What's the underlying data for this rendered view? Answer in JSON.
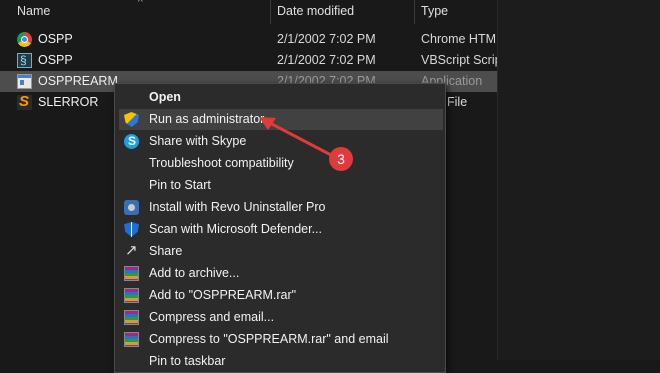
{
  "columns": {
    "name": "Name",
    "date_modified": "Date modified",
    "type": "Type"
  },
  "files": [
    {
      "name": "OSPP",
      "date": "2/1/2002 7:02 PM",
      "type": "Chrome HTML Document",
      "icon": "chrome-file-icon",
      "selected": false
    },
    {
      "name": "OSPP",
      "date": "2/1/2002 7:02 PM",
      "type": "VBScript Script File",
      "icon": "vbscript-file-icon",
      "selected": false
    },
    {
      "name": "OSPPREARM",
      "date": "2/1/2002 7:02 PM",
      "type": "Application",
      "icon": "application-icon",
      "selected": true
    },
    {
      "name": "SLERROR",
      "date": "",
      "type": "File",
      "icon": "sublime-file-icon",
      "selected": false
    }
  ],
  "context_menu": [
    {
      "label": "Open",
      "icon": "",
      "bold": true
    },
    {
      "label": "Run as administrator",
      "icon": "uac-shield-icon",
      "hover": true
    },
    {
      "label": "Share with Skype",
      "icon": "skype-icon"
    },
    {
      "label": "Troubleshoot compatibility",
      "icon": ""
    },
    {
      "label": "Pin to Start",
      "icon": ""
    },
    {
      "label": "Install with Revo Uninstaller Pro",
      "icon": "revo-uninstaller-icon"
    },
    {
      "label": "Scan with Microsoft Defender...",
      "icon": "defender-icon"
    },
    {
      "label": "Share",
      "icon": "share-icon"
    },
    {
      "label": "Add to archive...",
      "icon": "winrar-icon"
    },
    {
      "label": "Add to \"OSPPREARM.rar\"",
      "icon": "winrar-icon"
    },
    {
      "label": "Compress and email...",
      "icon": "winrar-icon"
    },
    {
      "label": "Compress to \"OSPPREARM.rar\" and email",
      "icon": "winrar-icon"
    },
    {
      "label": "Pin to taskbar",
      "icon": ""
    }
  ],
  "annotation": {
    "step_number": "3",
    "color": "#e03a3a"
  }
}
